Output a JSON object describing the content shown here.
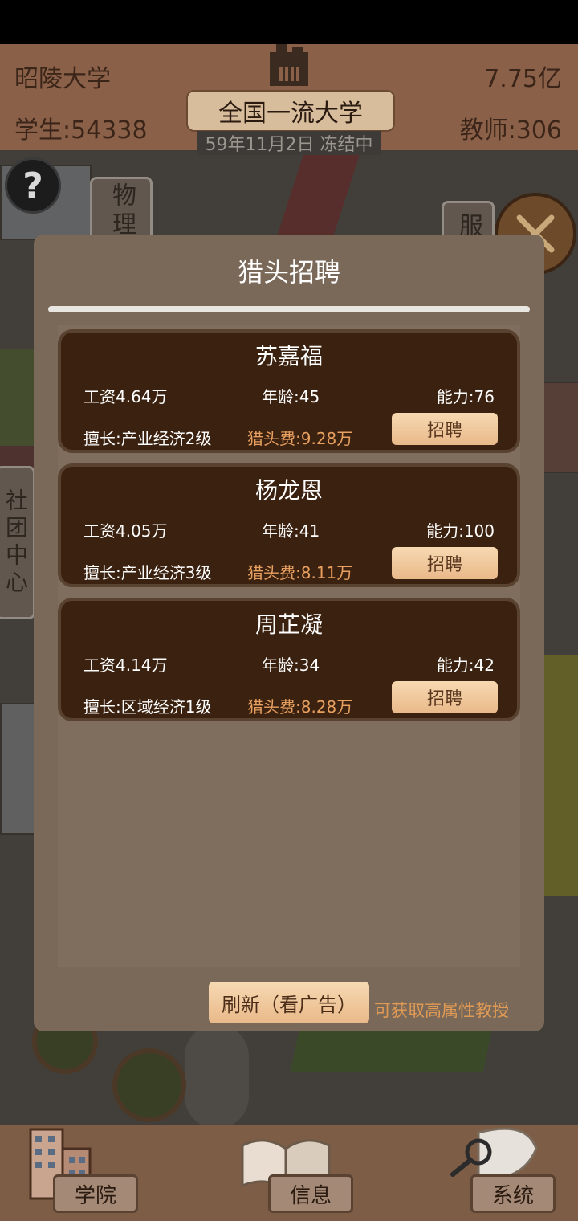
{
  "header": {
    "school_name": "昭陵大学",
    "money": "7.75亿",
    "students": "学生:54338",
    "teachers": "教师:306",
    "rank": "全国一流大学",
    "date_status": "59年11月2日 冻结中"
  },
  "campus_signs": {
    "physics": "物理",
    "clothing": "服",
    "club_center": "社团中心"
  },
  "dialog": {
    "title": "猎头招聘",
    "candidates": [
      {
        "name": "苏嘉福",
        "salary": "工资4.64万",
        "age": "年龄:45",
        "ability": "能力:76",
        "skill": "擅长:产业经济2级",
        "fee": "猎头费:9.28万",
        "hire_label": "招聘"
      },
      {
        "name": "杨龙恩",
        "salary": "工资4.05万",
        "age": "年龄:41",
        "ability": "能力:100",
        "skill": "擅长:产业经济3级",
        "fee": "猎头费:8.11万",
        "hire_label": "招聘"
      },
      {
        "name": "周芷凝",
        "salary": "工资4.14万",
        "age": "年龄:34",
        "ability": "能力:42",
        "skill": "擅长:区域经济1级",
        "fee": "猎头费:8.28万",
        "hire_label": "招聘"
      }
    ],
    "refresh_label": "刷新（看广告）",
    "refresh_hint": "可获取高属性教授"
  },
  "bottom_nav": {
    "college": "学院",
    "info": "信息",
    "system": "系统"
  },
  "colors": {
    "card_bg": "#3b210f",
    "dialog_bg": "#7a6958",
    "fee_orange": "#e8a060",
    "button": "#eebf92"
  }
}
